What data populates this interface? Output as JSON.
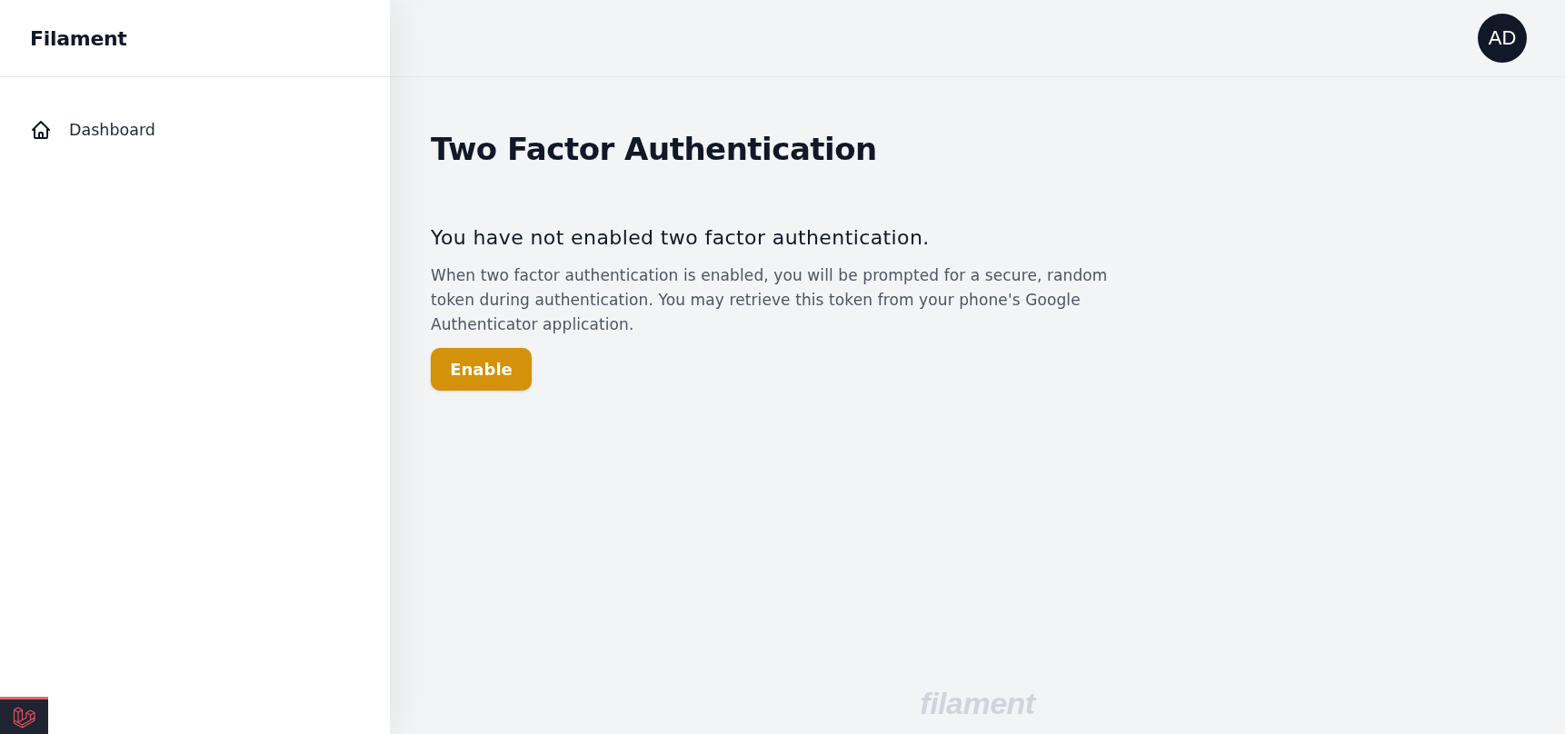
{
  "sidebar": {
    "brand": "Filament",
    "items": [
      {
        "label": "Dashboard",
        "selected": false
      }
    ]
  },
  "topbar": {
    "avatar": "AD"
  },
  "page": {
    "title": "Two Factor Authentication",
    "heading": "You have not enabled two factor authentication.",
    "description": "When two factor authentication is enabled, you will be prompted for a secure, random token during authentication. You may retrieve this token from your phone's Google Authenticator application.",
    "button": "Enable"
  },
  "footer": {
    "brand": "filament"
  }
}
